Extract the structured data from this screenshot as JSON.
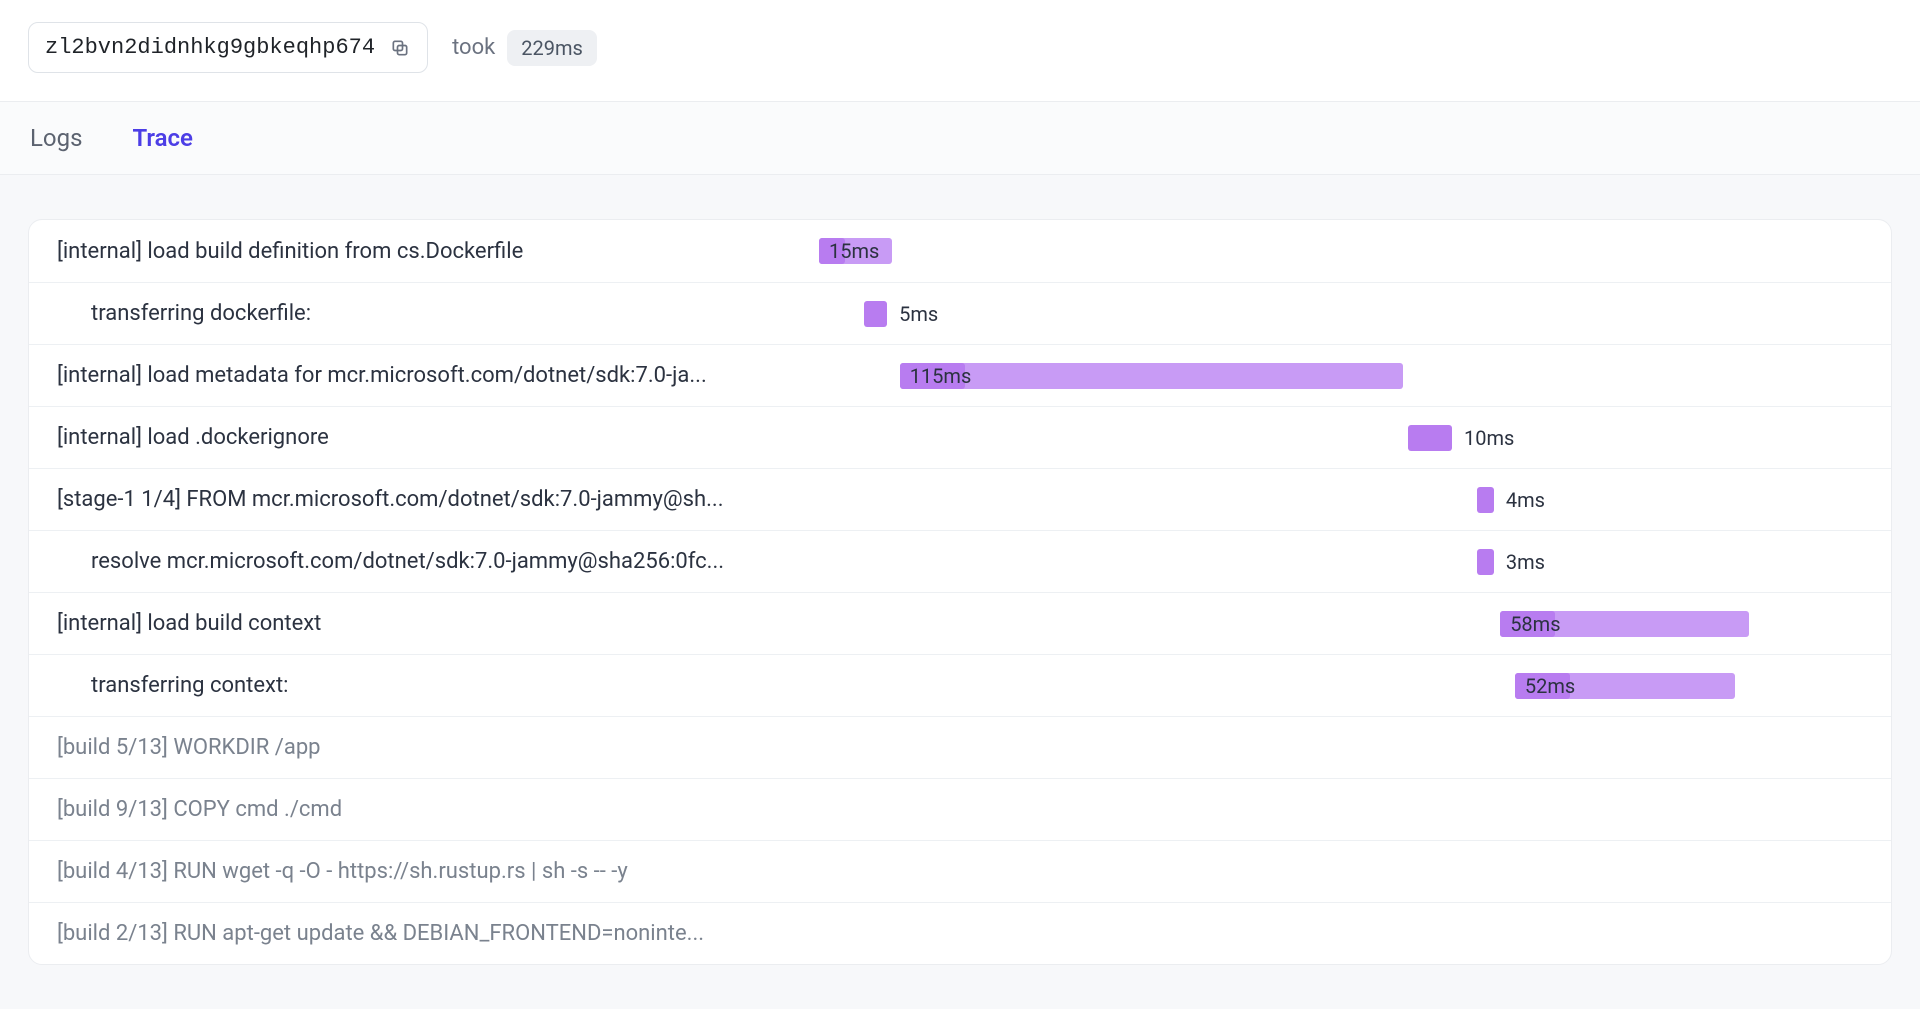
{
  "header": {
    "build_id": "zl2bvn2didnhkg9gbkeqhp674",
    "took_label": "took",
    "took_value": "229ms"
  },
  "tabs": {
    "logs": "Logs",
    "trace": "Trace",
    "active": "trace"
  },
  "trace": {
    "rows": [
      {
        "label": "[internal] load build definition from cs.Dockerfile",
        "indent": 0,
        "cached": false,
        "duration": "15ms",
        "bar": {
          "left_pct": 0.0,
          "width_pct": 7.0,
          "fg_pct": 35,
          "text_pos": "inside"
        }
      },
      {
        "label": "transferring dockerfile:",
        "indent": 1,
        "cached": false,
        "duration": "5ms",
        "bar": {
          "left_pct": 4.3,
          "width_pct": 2.2,
          "fg_pct": 100,
          "text_pos": "after"
        }
      },
      {
        "label": "[internal] load metadata for mcr.microsoft.com/dotnet/sdk:7.0-ja...",
        "indent": 0,
        "cached": false,
        "duration": "115ms",
        "bar": {
          "left_pct": 7.7,
          "width_pct": 48.0,
          "fg_pct": 13,
          "text_pos": "inside"
        }
      },
      {
        "label": "[internal] load .dockerignore",
        "indent": 0,
        "cached": false,
        "duration": "10ms",
        "bar": {
          "left_pct": 56.2,
          "width_pct": 4.2,
          "fg_pct": 100,
          "text_pos": "after"
        }
      },
      {
        "label": "[stage-1 1/4] FROM mcr.microsoft.com/dotnet/sdk:7.0-jammy@sh...",
        "indent": 0,
        "cached": false,
        "duration": "4ms",
        "bar": {
          "left_pct": 62.8,
          "width_pct": 1.6,
          "fg_pct": 100,
          "text_pos": "after"
        }
      },
      {
        "label": "resolve mcr.microsoft.com/dotnet/sdk:7.0-jammy@sha256:0fc...",
        "indent": 1,
        "cached": false,
        "duration": "3ms",
        "bar": {
          "left_pct": 62.8,
          "width_pct": 1.6,
          "fg_pct": 100,
          "text_pos": "after"
        }
      },
      {
        "label": "[internal] load build context",
        "indent": 0,
        "cached": false,
        "duration": "58ms",
        "bar": {
          "left_pct": 65.0,
          "width_pct": 23.7,
          "fg_pct": 22,
          "text_pos": "inside"
        }
      },
      {
        "label": "transferring context:",
        "indent": 1,
        "cached": false,
        "duration": "52ms",
        "bar": {
          "left_pct": 66.4,
          "width_pct": 21.0,
          "fg_pct": 25,
          "text_pos": "inside"
        }
      },
      {
        "label": "[build 5/13] WORKDIR /app",
        "indent": 0,
        "cached": true
      },
      {
        "label": "[build 9/13] COPY cmd ./cmd",
        "indent": 0,
        "cached": true
      },
      {
        "label": "[build 4/13] RUN wget -q -O - https://sh.rustup.rs | sh -s -- -y",
        "indent": 0,
        "cached": true
      },
      {
        "label": "[build 2/13] RUN apt-get update && DEBIAN_FRONTEND=noninte...",
        "indent": 0,
        "cached": true
      }
    ]
  },
  "colors": {
    "bar_bg": "#c89bf5",
    "bar_fg": "#b87cf0",
    "accent": "#4c3ee6"
  }
}
